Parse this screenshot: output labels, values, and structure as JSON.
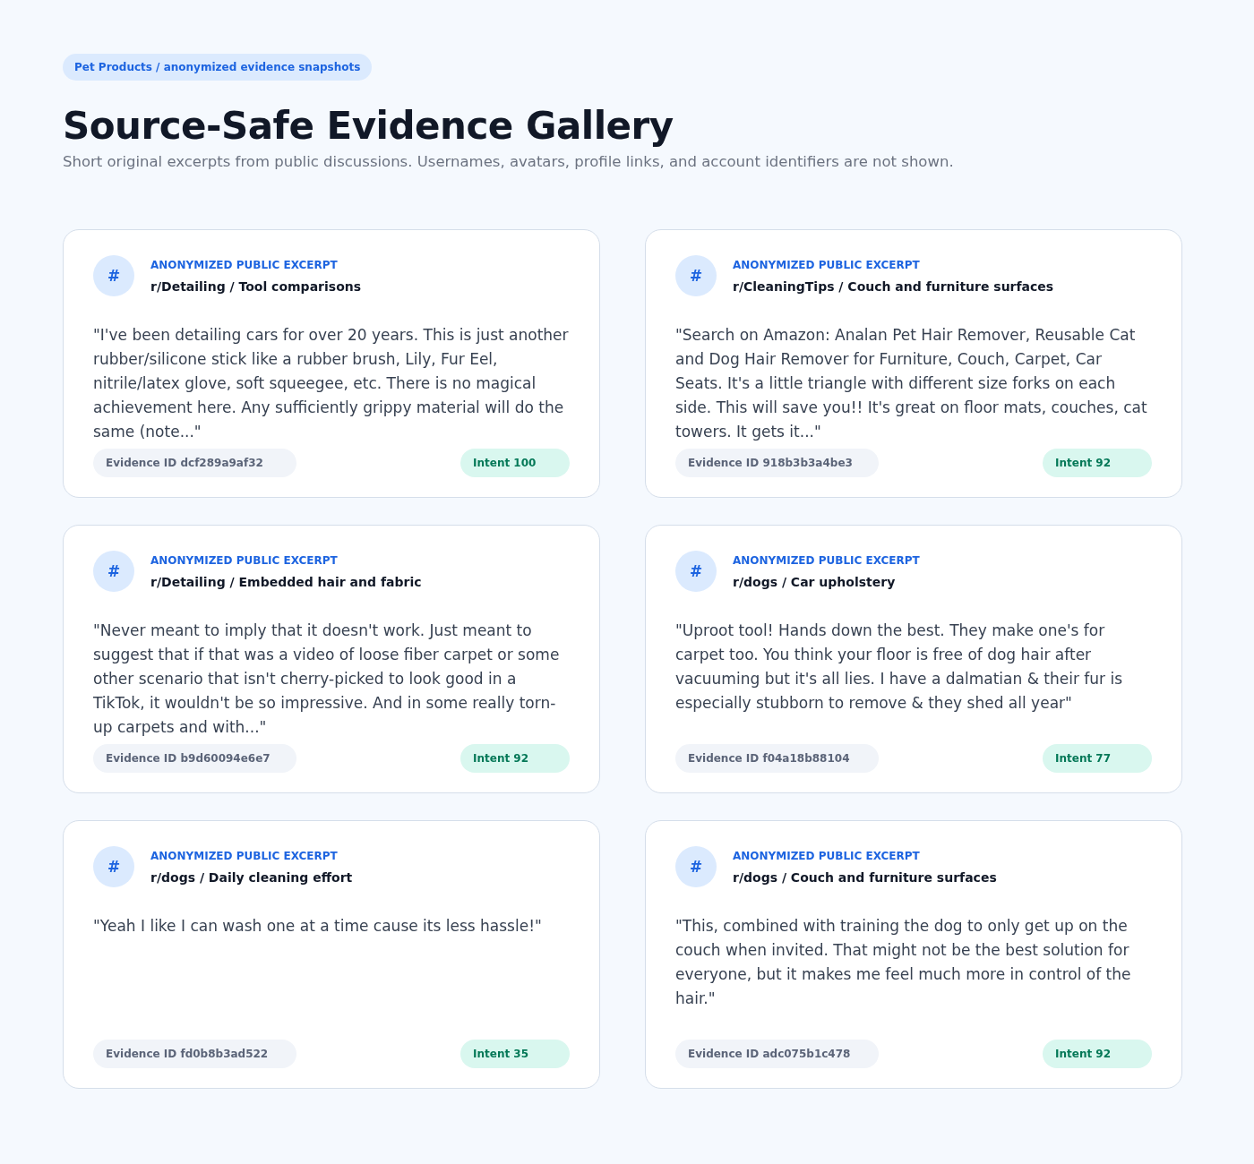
{
  "breadcrumb": "Pet Products / anonymized evidence snapshots",
  "title": "Source-Safe Evidence Gallery",
  "subtitle": "Short original excerpts from public discussions. Usernames, avatars, profile links, and account identifiers are not shown.",
  "cards": [
    {
      "icon": "#",
      "label": "ANONYMIZED PUBLIC EXCERPT",
      "source": "r/Detailing / Tool comparisons",
      "quote": "\"I've been detailing cars for over 20 years. This is just another rubber/silicone stick like a rubber brush, Lily, Fur Eel, nitrile/latex glove, soft squeegee, etc. There is no magical achievement here. Any sufficiently grippy material will do the same (note...\"",
      "evidence_id": "Evidence ID dcf289a9af32",
      "intent": "Intent 100"
    },
    {
      "icon": "#",
      "label": "ANONYMIZED PUBLIC EXCERPT",
      "source": "r/CleaningTips / Couch and furniture surfaces",
      "quote": "\"Search on Amazon: Analan Pet Hair Remover, Reusable Cat and Dog Hair Remover for Furniture, Couch, Carpet, Car Seats. It's a little triangle with different size forks on each side. This will save you!! It's great on floor mats, couches, cat towers. It gets it...\"",
      "evidence_id": "Evidence ID 918b3b3a4be3",
      "intent": "Intent 92"
    },
    {
      "icon": "#",
      "label": "ANONYMIZED PUBLIC EXCERPT",
      "source": "r/Detailing / Embedded hair and fabric",
      "quote": "\"Never meant to imply that it doesn't work. Just meant to suggest that if that was a video of loose fiber carpet or some other scenario that isn't cherry-picked to look good in a TikTok, it wouldn't be so impressive. And in some really torn-up carpets and with...\"",
      "evidence_id": "Evidence ID b9d60094e6e7",
      "intent": "Intent 92"
    },
    {
      "icon": "#",
      "label": "ANONYMIZED PUBLIC EXCERPT",
      "source": "r/dogs / Car upholstery",
      "quote": "\"Uproot tool! Hands down the best. They make one's for carpet too. You think your floor is free of dog hair after vacuuming but it's all lies. I have a dalmatian & their fur is especially stubborn to remove & they shed all year\"",
      "evidence_id": "Evidence ID f04a18b88104",
      "intent": "Intent 77"
    },
    {
      "icon": "#",
      "label": "ANONYMIZED PUBLIC EXCERPT",
      "source": "r/dogs / Daily cleaning effort",
      "quote": "\"Yeah I like I can wash one at a time cause its less hassle!\"",
      "evidence_id": "Evidence ID fd0b8b3ad522",
      "intent": "Intent 35"
    },
    {
      "icon": "#",
      "label": "ANONYMIZED PUBLIC EXCERPT",
      "source": "r/dogs / Couch and furniture surfaces",
      "quote": "\"This, combined with training the dog to only get up on the couch when invited. That might not be the best solution for everyone, but it makes me feel much more in control of the hair.\"",
      "evidence_id": "Evidence ID adc075b1c478",
      "intent": "Intent 92"
    }
  ]
}
